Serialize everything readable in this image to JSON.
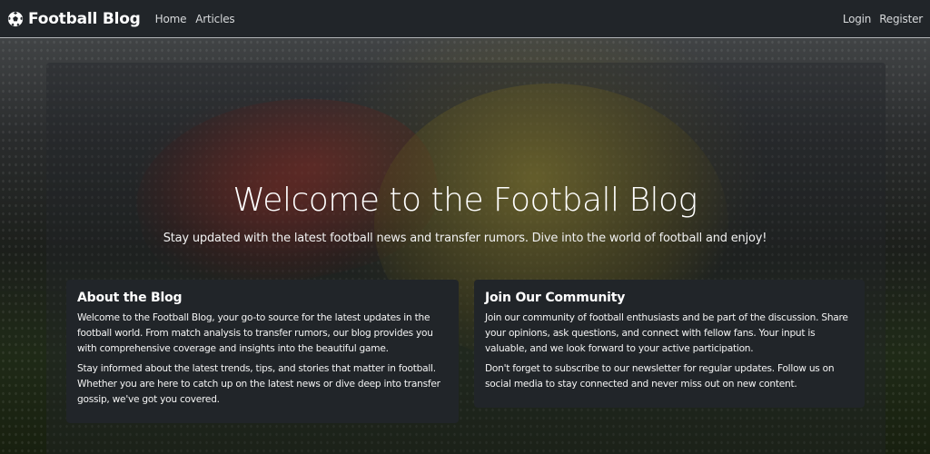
{
  "navbar": {
    "brand_icon": "soccer-ball-icon",
    "brand": "Football Blog",
    "links_left": [
      "Home",
      "Articles"
    ],
    "links_right": [
      "Login",
      "Register"
    ]
  },
  "hero": {
    "title": "Welcome to the Football Blog",
    "subtitle": "Stay updated with the latest football news and transfer rumors. Dive into the world of football and enjoy!"
  },
  "cards": [
    {
      "title": "About the Blog",
      "paragraphs": [
        "Welcome to the Football Blog, your go-to source for the latest updates in the football world. From match analysis to transfer rumors, our blog provides you with comprehensive coverage and insights into the beautiful game.",
        "Stay informed about the latest trends, tips, and stories that matter in football. Whether you are here to catch up on the latest news or dive deep into transfer gossip, we've got you covered."
      ]
    },
    {
      "title": "Join Our Community",
      "paragraphs": [
        "Join our community of football enthusiasts and be part of the discussion. Share your opinions, ask questions, and connect with fellow fans. Your input is valuable, and we look forward to your active participation.",
        "Don't forget to subscribe to our newsletter for regular updates. Follow us on social media to stay connected and never miss out on new content."
      ]
    }
  ],
  "colors": {
    "navbar_bg": "#212529",
    "card_bg": "#212529",
    "text": "#ffffff"
  }
}
